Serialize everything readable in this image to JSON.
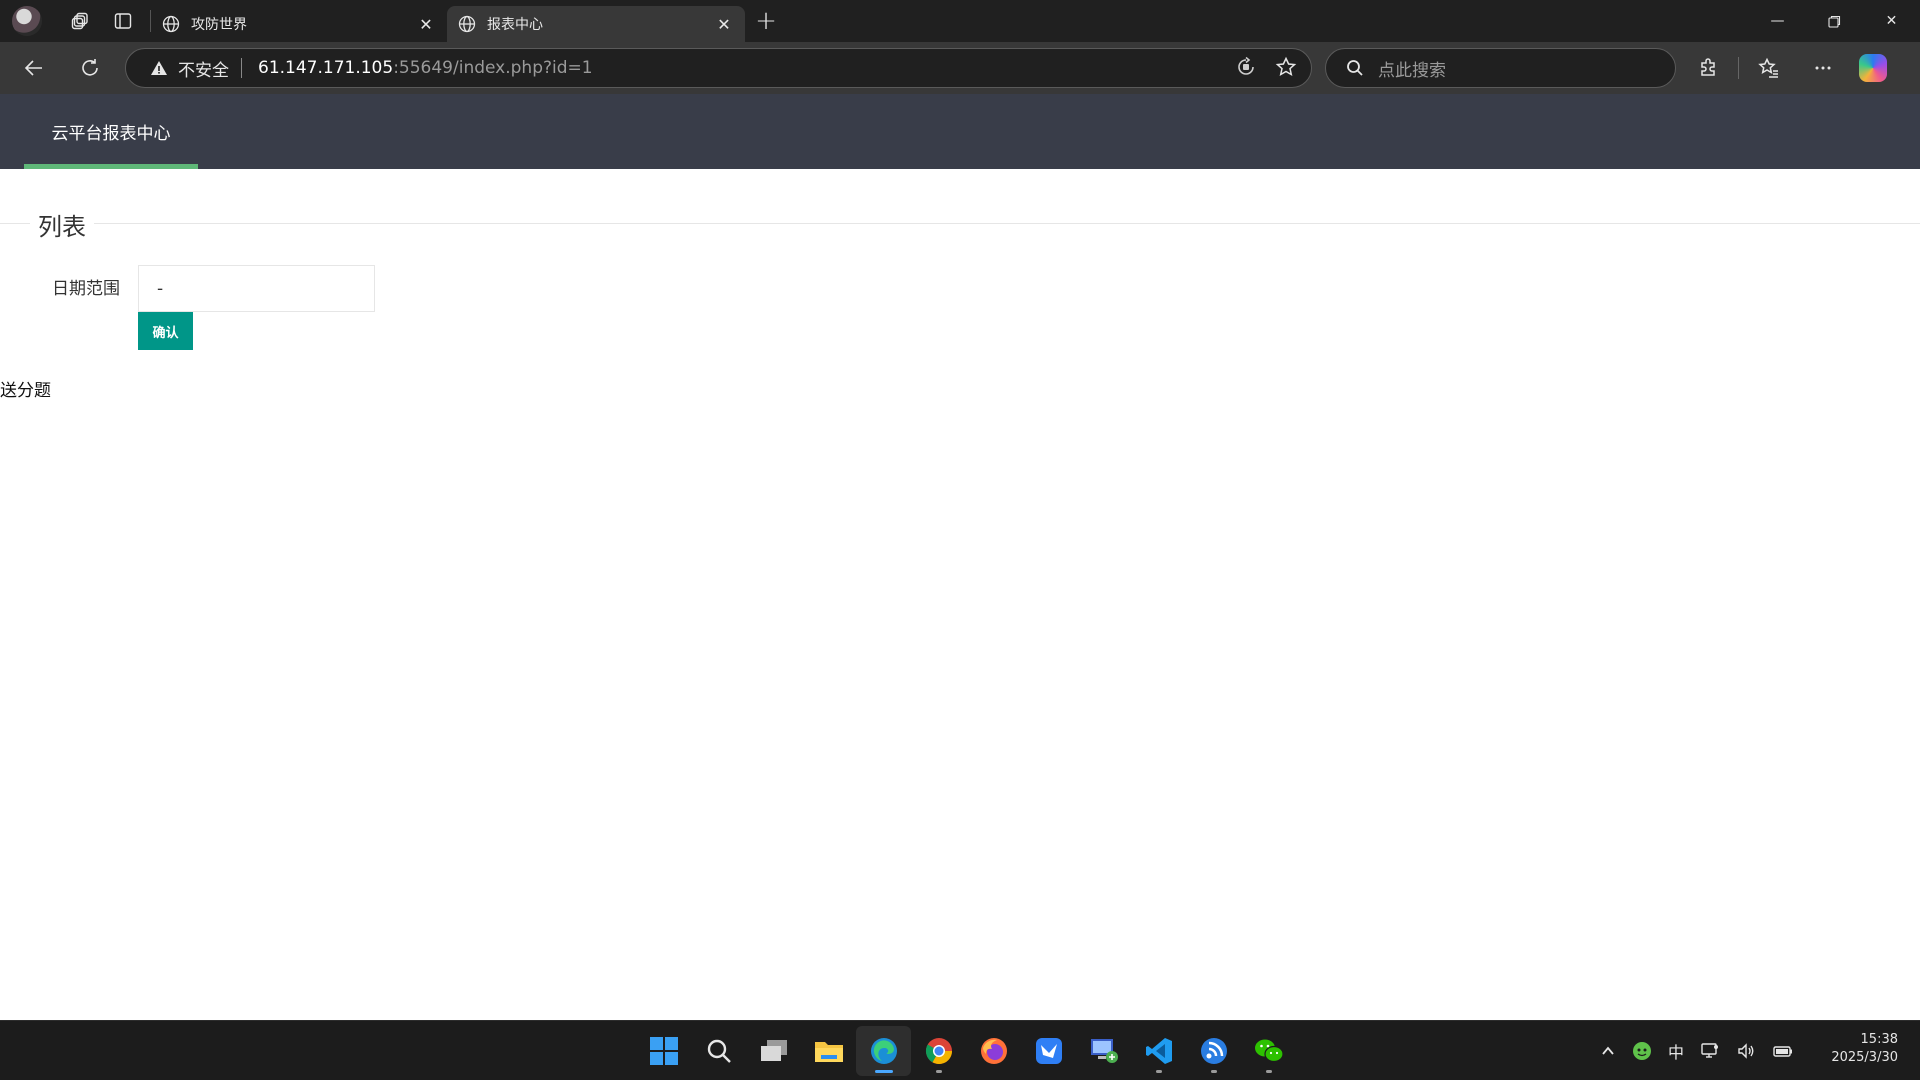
{
  "browser": {
    "tabs": [
      {
        "title": "攻防世界",
        "active": false
      },
      {
        "title": "报表中心",
        "active": true
      }
    ],
    "address": {
      "security_label": "不安全",
      "host": "61.147.171.105",
      "path": ":55649/index.php?id=1"
    },
    "search": {
      "placeholder": "点此搜索"
    }
  },
  "page": {
    "nav": {
      "title": "云平台报表中心"
    },
    "legend": "列表",
    "form": {
      "date_label": "日期范围",
      "date_value": "-",
      "confirm_label": "确认"
    },
    "result": "送分题"
  },
  "taskbar": {
    "ime": "中",
    "time": "15:38",
    "date": "2025/3/30"
  },
  "colors": {
    "navbar": "#393d49",
    "nav_underline": "#5fb878",
    "confirm_button": "#009688"
  }
}
